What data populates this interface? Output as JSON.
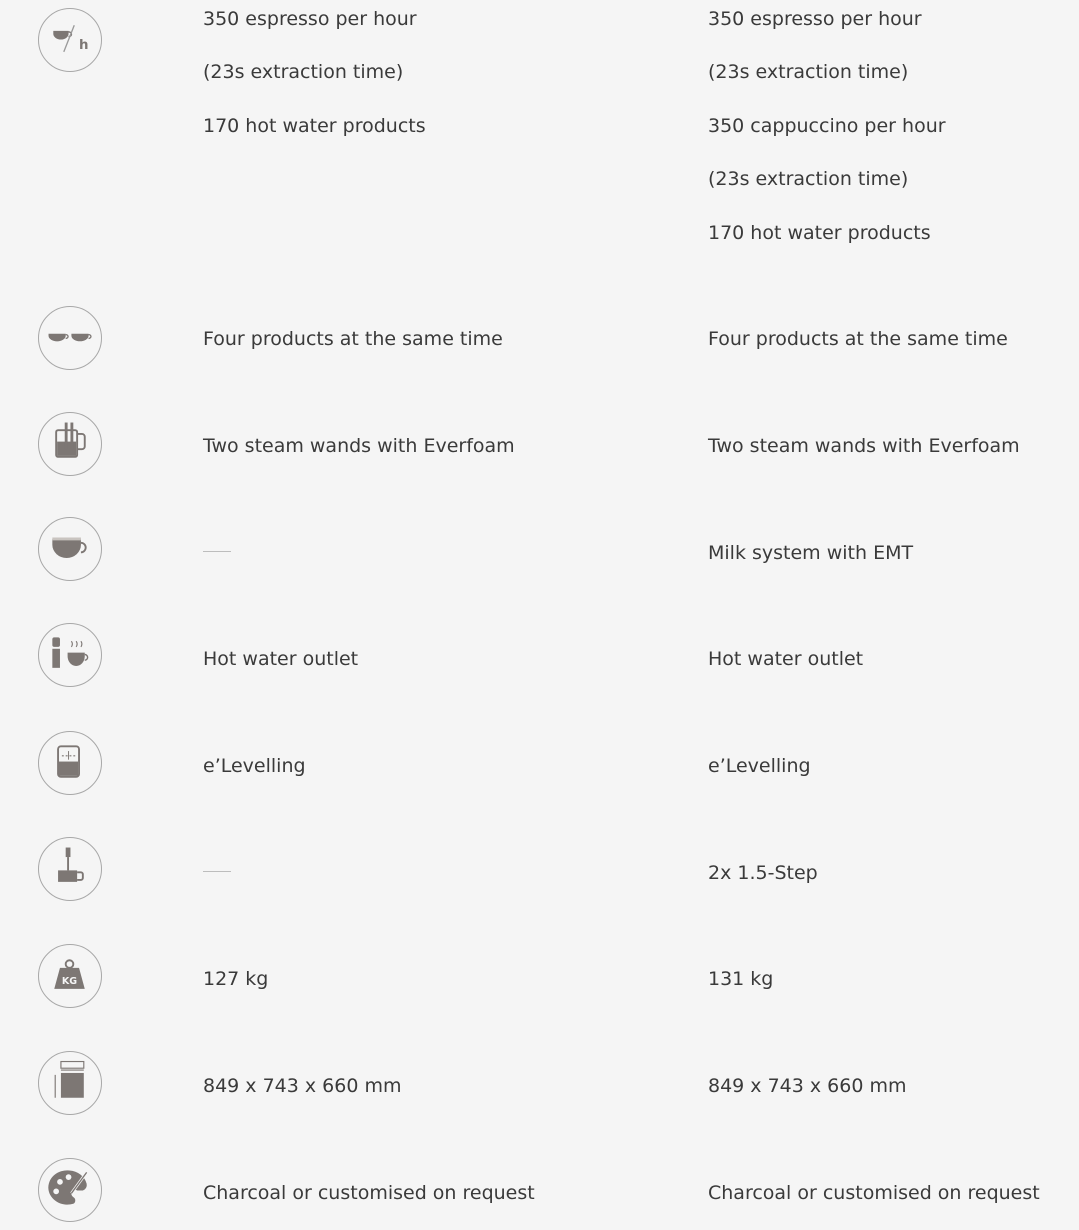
{
  "rows": [
    {
      "icon": "cups-per-hour-icon",
      "col1": [
        "350 espresso per hour",
        "(23s extraction time)",
        "170 hot water products"
      ],
      "col2": [
        "350 espresso per hour",
        "(23s extraction time)",
        "350 cappuccino per hour",
        "(23s extraction time)",
        "170 hot water products"
      ]
    },
    {
      "icon": "two-cups-icon",
      "col1": [
        "Four products at the same time"
      ],
      "col2": [
        "Four products at the same time"
      ]
    },
    {
      "icon": "steam-wand-pitcher-icon",
      "col1": [
        "Two steam wands with Everfoam"
      ],
      "col2": [
        "Two steam wands with Everfoam"
      ]
    },
    {
      "icon": "milk-cup-icon",
      "col1": [],
      "col2": [
        "Milk system with EMT"
      ]
    },
    {
      "icon": "hot-water-outlet-icon",
      "col1": [
        "Hot water outlet"
      ],
      "col2": [
        "Hot water outlet"
      ]
    },
    {
      "icon": "levelling-glass-icon",
      "col1": [
        "e’Levelling"
      ],
      "col2": [
        "e’Levelling"
      ]
    },
    {
      "icon": "milk-frother-step-icon",
      "col1": [],
      "col2": [
        "2x 1.5-Step"
      ]
    },
    {
      "icon": "weight-kg-icon",
      "col1": [
        "127 kg"
      ],
      "col2": [
        "131 kg"
      ]
    },
    {
      "icon": "dimensions-icon",
      "col1": [
        "849 x 743 x 660 mm"
      ],
      "col2": [
        "849 x 743 x 660 mm"
      ]
    },
    {
      "icon": "palette-color-icon",
      "col1": [
        "Charcoal or customised on request"
      ],
      "col2": [
        "Charcoal or customised on request"
      ]
    }
  ],
  "weight_badge_text": "KG",
  "time_unit_text": "h",
  "colors": {
    "background": "#f5f5f5",
    "text": "#3a3a3a",
    "icon": "#7d7774",
    "circle_border": "#a8a8a8"
  }
}
